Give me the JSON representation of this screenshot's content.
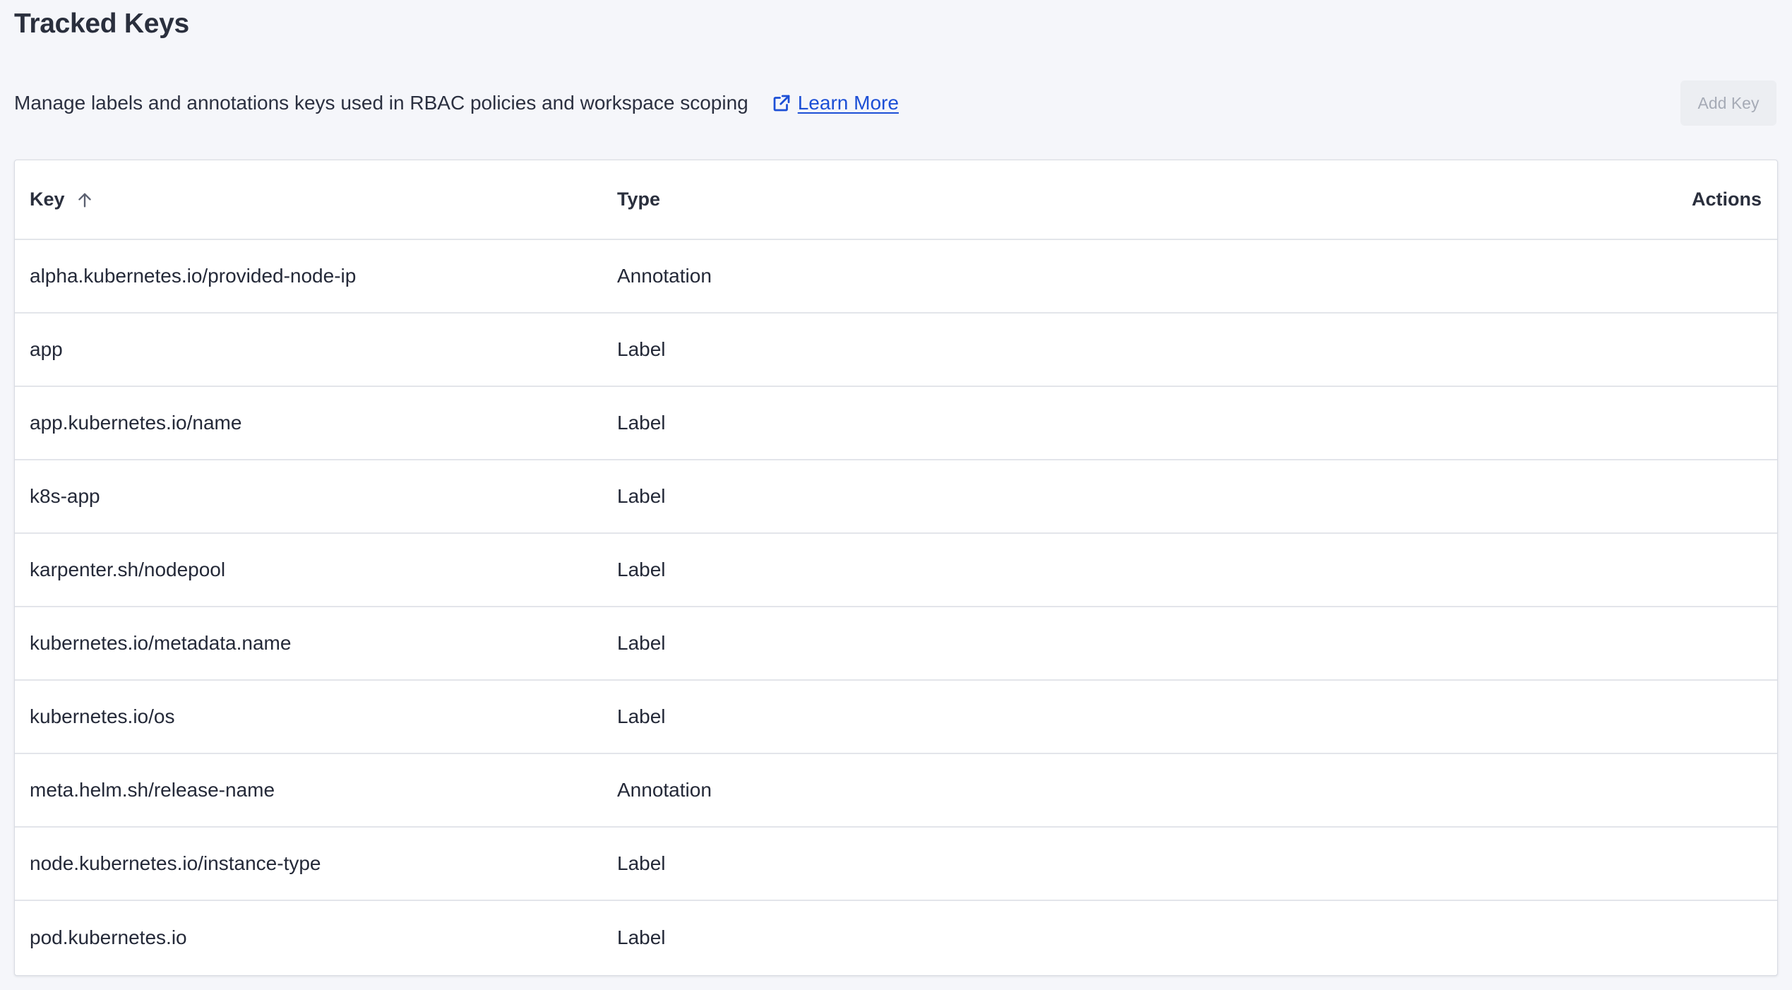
{
  "page": {
    "title": "Tracked Keys",
    "description": "Manage labels and annotations keys used in RBAC policies and workspace scoping",
    "learn_more_label": "Learn More",
    "add_key_label": "Add Key"
  },
  "table": {
    "headers": {
      "key": "Key",
      "type": "Type",
      "actions": "Actions"
    },
    "sort": {
      "column": "Key",
      "direction": "ascending",
      "icon": "arrow-up-icon"
    },
    "rows": [
      {
        "key": "alpha.kubernetes.io/provided-node-ip",
        "type": "Annotation"
      },
      {
        "key": "app",
        "type": "Label"
      },
      {
        "key": "app.kubernetes.io/name",
        "type": "Label"
      },
      {
        "key": "k8s-app",
        "type": "Label"
      },
      {
        "key": "karpenter.sh/nodepool",
        "type": "Label"
      },
      {
        "key": "kubernetes.io/metadata.name",
        "type": "Label"
      },
      {
        "key": "kubernetes.io/os",
        "type": "Label"
      },
      {
        "key": "meta.helm.sh/release-name",
        "type": "Annotation"
      },
      {
        "key": "node.kubernetes.io/instance-type",
        "type": "Label"
      },
      {
        "key": "pod.kubernetes.io",
        "type": "Label"
      }
    ]
  },
  "colors": {
    "background": "#f5f6fa",
    "link": "#1c4fd6",
    "disabled_button_bg": "#eceef2",
    "disabled_button_text": "#a6abb6"
  },
  "icons": {
    "learn_more": "external-link-icon",
    "sort": "arrow-up-icon"
  }
}
